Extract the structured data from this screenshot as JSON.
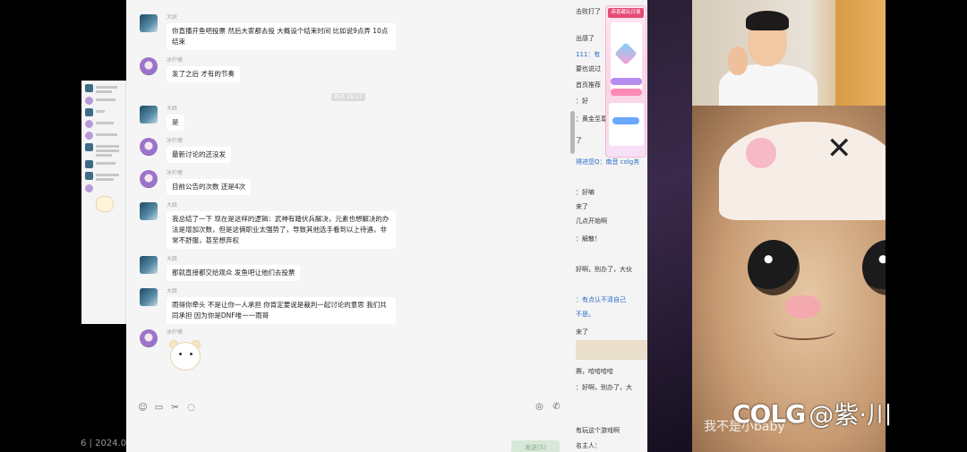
{
  "chat": {
    "messages": [
      {
        "sender": "大跃",
        "text": "你直播开鱼吧投票 然后大家都去投 大概设个结束时间 比如说9点弄 10点结束",
        "gender": "male"
      },
      {
        "sender": "冰柠檬",
        "text": "发了之后 才有的节奏",
        "gender": "female"
      },
      {
        "sender": "大跃",
        "text": "是",
        "gender": "male"
      },
      {
        "sender": "冰柠檬",
        "text": "最新讨论的还没发",
        "gender": "female"
      },
      {
        "sender": "冰柠檬",
        "text": "目前公告的次数 还是4次",
        "gender": "female"
      },
      {
        "sender": "大跃",
        "text": "我总结了一下 现在是这样的逻辑：武神有踏伏兵解决，元素也想解决的办法是增加次数，但是这俩职业太强势了，导致其他选手看到以上待遇，非常不舒服，甚至想弃权",
        "gender": "male"
      },
      {
        "sender": "大跃",
        "text": "那就直接都交给观众 发鱼吧让他们去投票",
        "gender": "male"
      },
      {
        "sender": "大跃",
        "text": "雨得你牵头 不是让你一人承担 你肯定要说是裁判一起讨论的意思 我们共同承担 因为你是DNF唯一一雨哥",
        "gender": "male"
      },
      {
        "sender": "冰柠檬",
        "text": "",
        "gender": "female"
      }
    ],
    "time_chip": "昨天 18:17",
    "send_label": "发送(S)"
  },
  "comments": [
    {
      "text": "击败打了",
      "hl": false
    },
    {
      "text": "出感了",
      "hl": false
    },
    {
      "text": "111：有",
      "hl": true
    },
    {
      "text": "要也说过",
      "hl": false
    },
    {
      "text": "首页推荐",
      "hl": false
    },
    {
      "text": "：好",
      "hl": false
    },
    {
      "text": "：黄金至尊",
      "hl": false
    },
    {
      "text": "了",
      "hl": false
    },
    {
      "text": "得进您Q：南音 colg务",
      "hl": true
    },
    {
      "text": "：好嘛",
      "hl": false
    },
    {
      "text": "来了",
      "hl": false
    },
    {
      "text": "几点开始啊",
      "hl": false
    },
    {
      "text": "：解散！",
      "hl": false
    },
    {
      "text": "好啊，别办了，大伙",
      "hl": false
    },
    {
      "text": "：有点认不清自己",
      "hl": true
    },
    {
      "text": "不是。",
      "hl": true
    },
    {
      "text": "来了",
      "hl": false
    },
    {
      "text": "赛，哈哈哈哈",
      "hl": false
    },
    {
      "text": "：好啊，别办了，大",
      "hl": false
    },
    {
      "text": "有玩这个游戏啊",
      "hl": false
    },
    {
      "text": "名主人：",
      "hl": false
    }
  ],
  "promo": {
    "title": "恭喜藏玩日报"
  },
  "cat_caption": "我不是小baby",
  "watermark": {
    "logo": "COLG",
    "handle": "@紫·川"
  },
  "date_fragment": "6 | 2024.0"
}
